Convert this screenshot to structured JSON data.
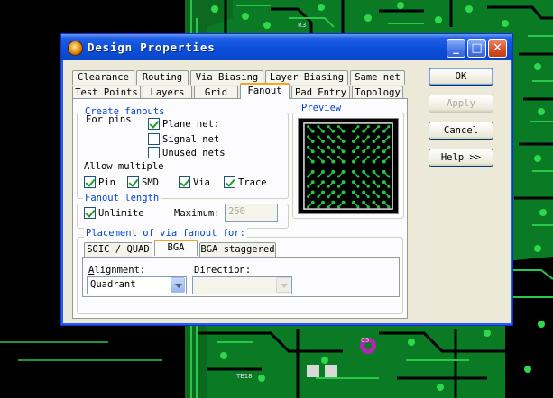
{
  "dialog": {
    "title": "Design Properties"
  },
  "window_buttons": {
    "minimize": "_",
    "maximize": "□",
    "close": "✕"
  },
  "tabs_row1": [
    "Clearance",
    "Routing",
    "Via Biasing",
    "Layer Biasing",
    "Same net"
  ],
  "tabs_row2": [
    "Test Points",
    "Layers",
    "Grid",
    "Fanout",
    "Pad Entry",
    "Topology"
  ],
  "active_tab": "Fanout",
  "create_fanouts": {
    "title": "Create fanouts",
    "for_pins": "For pins",
    "plane_net": {
      "label": "Plane net:",
      "checked": true
    },
    "signal_net": {
      "label": "Signal net",
      "checked": false
    },
    "unused_nets": {
      "label": "Unused nets",
      "checked": false
    },
    "allow_multiple": "Allow multiple",
    "pin": {
      "label": "Pin",
      "checked": true
    },
    "smd": {
      "label": "SMD",
      "checked": true
    },
    "via": {
      "label": "Via",
      "checked": true
    },
    "trace": {
      "label": "Trace",
      "checked": true
    }
  },
  "preview": {
    "title": "Preview",
    "fanout_count": 64
  },
  "fanout_length": {
    "title": "Fanout length",
    "unlimited": {
      "label": "Unlimite",
      "checked": true
    },
    "maximum_label": "Maximum:",
    "maximum_value": "250"
  },
  "placement": {
    "title": "Placement of via fanout for:",
    "subtabs": [
      "SOIC / QUAD",
      "BGA",
      "BGA staggered"
    ],
    "active_subtab": "BGA",
    "alignment_label": "Alignment:",
    "alignment_value": "Quadrant",
    "direction_label": "Direction:",
    "direction_value": ""
  },
  "buttons": {
    "ok": "OK",
    "apply": "Apply",
    "cancel": "Cancel",
    "help": "Help >>"
  },
  "colors": {
    "title_blue": "#0b4fd8",
    "dialog_bg": "#ece9d8",
    "group_title": "#0046d5",
    "pcb_green": "#0a8a2a",
    "pcb_bg": "#000000",
    "preview_pad": "#23c840"
  }
}
